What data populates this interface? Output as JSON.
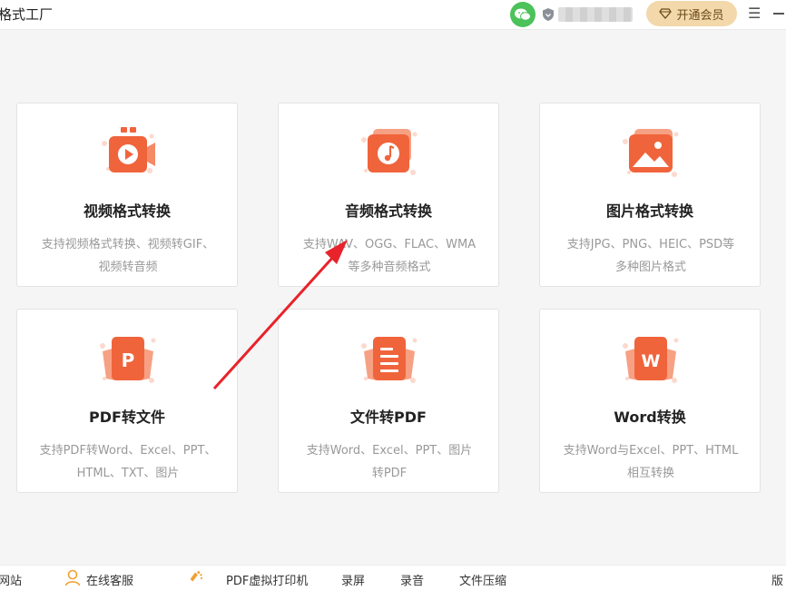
{
  "app": {
    "title": "格式工厂"
  },
  "header": {
    "vip_label": "开通会员"
  },
  "cards": [
    {
      "title": "视频格式转换",
      "desc_lines": [
        "支持视频格式转换、视频转GIF、",
        "视频转音频"
      ],
      "icon": "video-camera-icon"
    },
    {
      "title": "音频格式转换",
      "desc_lines": [
        "支持WAV、OGG、FLAC、WMA",
        "等多种音频格式"
      ],
      "icon": "music-note-icon"
    },
    {
      "title": "图片格式转换",
      "desc_lines": [
        "支持JPG、PNG、HEIC、PSD等",
        "多种图片格式"
      ],
      "icon": "image-icon"
    },
    {
      "title": "PDF转文件",
      "desc_lines": [
        "支持PDF转Word、Excel、PPT、",
        "HTML、TXT、图片"
      ],
      "icon": "pdf-p-icon",
      "glyph": "P"
    },
    {
      "title": "文件转PDF",
      "desc_lines": [
        "支持Word、Excel、PPT、图片",
        "转PDF"
      ],
      "icon": "document-lines-icon"
    },
    {
      "title": "Word转换",
      "desc_lines": [
        "支持Word与Excel、PPT、HTML",
        "相互转换"
      ],
      "icon": "word-w-icon",
      "glyph": "W"
    }
  ],
  "footer": {
    "website": "网站",
    "support": "在线客服",
    "pdf_printer": "PDF虚拟打印机",
    "screen_record": "录屏",
    "audio_record": "录音",
    "file_compress": "文件压缩",
    "version": "版"
  },
  "colors": {
    "accent": "#f0643c",
    "vip_bg": "#f2d8aa",
    "wechat": "#4cc25a"
  }
}
